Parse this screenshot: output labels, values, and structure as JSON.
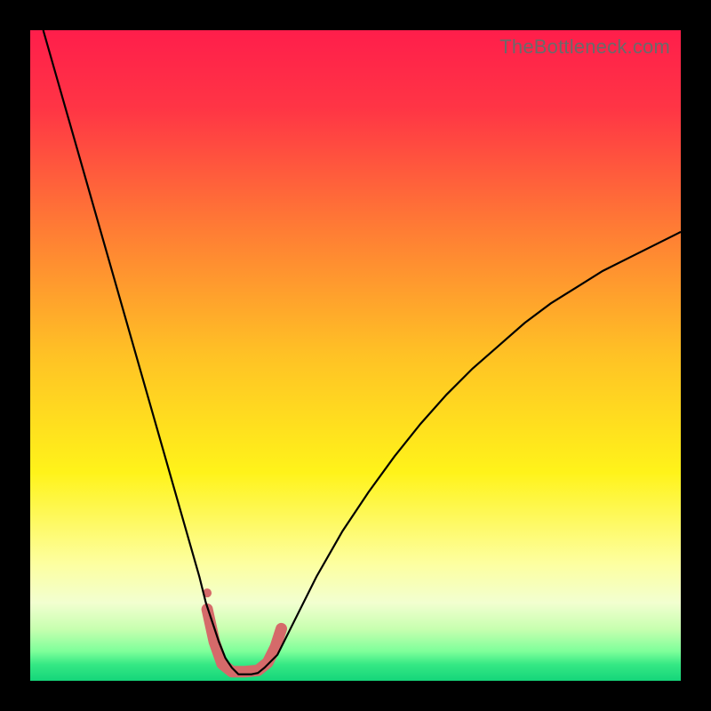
{
  "watermark": "TheBottleneck.com",
  "chart_data": {
    "type": "line",
    "title": "",
    "xlabel": "",
    "ylabel": "",
    "xlim": [
      0,
      100
    ],
    "ylim": [
      0,
      100
    ],
    "background_gradient": {
      "stops": [
        {
          "offset": 0.0,
          "color": "#ff1e4b"
        },
        {
          "offset": 0.12,
          "color": "#ff3545"
        },
        {
          "offset": 0.3,
          "color": "#ff7a35"
        },
        {
          "offset": 0.5,
          "color": "#ffc225"
        },
        {
          "offset": 0.68,
          "color": "#fff31a"
        },
        {
          "offset": 0.82,
          "color": "#fdffa0"
        },
        {
          "offset": 0.88,
          "color": "#f2ffd0"
        },
        {
          "offset": 0.92,
          "color": "#c8ffb0"
        },
        {
          "offset": 0.955,
          "color": "#7dff9a"
        },
        {
          "offset": 0.975,
          "color": "#35e884"
        },
        {
          "offset": 1.0,
          "color": "#15d67a"
        }
      ]
    },
    "series": [
      {
        "name": "bottleneck-curve",
        "stroke": "#000000",
        "stroke_width": 2.2,
        "x": [
          2,
          4,
          6,
          8,
          10,
          12,
          14,
          16,
          18,
          20,
          22,
          24,
          26,
          27,
          28,
          29,
          30,
          31,
          32,
          33,
          34,
          35,
          36,
          38,
          40,
          44,
          48,
          52,
          56,
          60,
          64,
          68,
          72,
          76,
          80,
          84,
          88,
          92,
          96,
          100
        ],
        "y": [
          100,
          93,
          86,
          79,
          72,
          65,
          58,
          51,
          44,
          37,
          30,
          23,
          16,
          12,
          9,
          6,
          3.5,
          2,
          1,
          1,
          1,
          1.2,
          2,
          4,
          8,
          16,
          23,
          29,
          34.5,
          39.5,
          44,
          48,
          51.5,
          55,
          58,
          60.5,
          63,
          65,
          67,
          69
        ]
      }
    ],
    "overlay_segment": {
      "name": "optimal-range-marker",
      "stroke": "#d56a6a",
      "stroke_width": 13,
      "linecap": "round",
      "points": [
        {
          "x": 27.2,
          "y": 11.0
        },
        {
          "x": 28.3,
          "y": 6.0
        },
        {
          "x": 29.5,
          "y": 2.6
        },
        {
          "x": 31.0,
          "y": 1.4
        },
        {
          "x": 33.0,
          "y": 1.4
        },
        {
          "x": 35.0,
          "y": 1.6
        },
        {
          "x": 36.5,
          "y": 2.8
        },
        {
          "x": 37.7,
          "y": 5.2
        },
        {
          "x": 38.6,
          "y": 8.0
        }
      ],
      "dot": {
        "x": 27.2,
        "y": 13.5,
        "r": 5
      }
    }
  }
}
